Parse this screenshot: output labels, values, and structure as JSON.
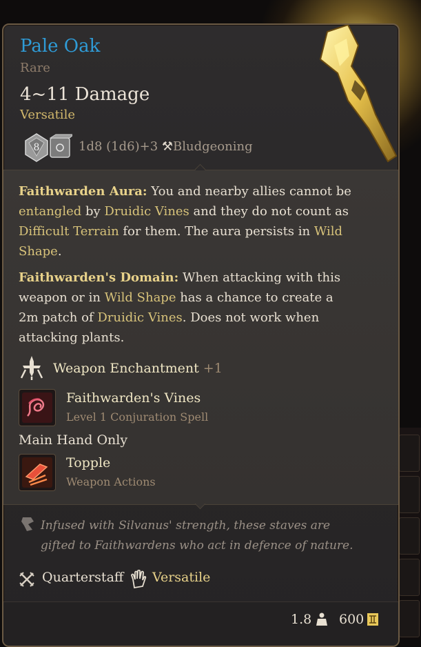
{
  "item": {
    "name": "Pale Oak",
    "rarity": "Rare",
    "damage": "4~11 Damage",
    "property_tag": "Versatile",
    "dice_label_1": "8",
    "dice_text": "1d8 (1d6)+3",
    "damage_type": "Bludgeoning"
  },
  "passives": [
    {
      "name": "Faithwarden Aura:",
      "segments": [
        {
          "t": " You and nearby allies cannot be ",
          "k": false
        },
        {
          "t": "entangled",
          "k": true
        },
        {
          "t": " by ",
          "k": false
        },
        {
          "t": "Druidic Vines",
          "k": true
        },
        {
          "t": " and they do not count as ",
          "k": false
        },
        {
          "t": "Difficult Terrain",
          "k": true
        },
        {
          "t": " for them. The aura persists in ",
          "k": false
        },
        {
          "t": "Wild Shape",
          "k": true
        },
        {
          "t": ".",
          "k": false
        }
      ]
    },
    {
      "name": "Faithwarden's Domain:",
      "segments": [
        {
          "t": " When attacking with this weapon or in ",
          "k": false
        },
        {
          "t": "Wild Shape",
          "k": true
        },
        {
          "t": " has a chance to create a 2m patch of ",
          "k": false
        },
        {
          "t": "Druidic Vines",
          "k": true
        },
        {
          "t": ". Does not work when attacking plants.",
          "k": false
        }
      ]
    }
  ],
  "enchantment": {
    "label": "Weapon Enchantment",
    "bonus": "+1"
  },
  "spell": {
    "name": "Faithwarden's Vines",
    "detail": "Level 1 Conjuration Spell"
  },
  "main_hand": "Main Hand Only",
  "action": {
    "name": "Topple",
    "detail": "Weapon Actions"
  },
  "lore": "Infused with Silvanus' strength, these staves are gifted to Faithwardens who act in defence of nature.",
  "properties": {
    "weapon_type": "Quarterstaff",
    "versatile": "Versatile"
  },
  "footer": {
    "weight": "1.8",
    "price": "600"
  },
  "colors": {
    "title": "#2f9bd6",
    "keyword": "#d8c37a",
    "rare": "#8e7c6a",
    "panel": "#353230"
  },
  "icons": {
    "dice": "d8-d6-dice-icon",
    "damage_type": "hammer-icon",
    "enchantment": "sword-enchant-icon",
    "spell": "vines-spell-icon",
    "action": "topple-action-icon",
    "lore": "quill-icon",
    "weapon_type": "crossed-swords-icon",
    "versatile": "hand-icon",
    "weight": "weight-icon",
    "price": "gold-coin-icon"
  }
}
